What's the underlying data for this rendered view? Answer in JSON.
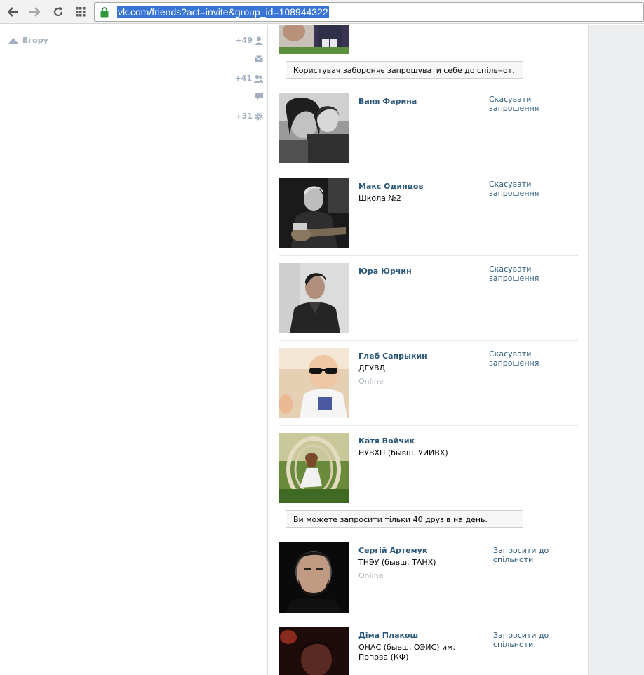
{
  "browser": {
    "url": "vk.com/friends?act=invite&group_id=108944322"
  },
  "sidebar": {
    "up_label": "Вгору",
    "counters": [
      {
        "count": "+49",
        "icon": "user-icon"
      },
      {
        "count": "",
        "icon": "mail-icon"
      },
      {
        "count": "+41",
        "icon": "users-icon"
      },
      {
        "count": "",
        "icon": "comment-icon"
      },
      {
        "count": "+31",
        "icon": "gear-icon"
      }
    ]
  },
  "notices": [
    "Користувач забороняє запрошувати себе до спільнот.",
    "Ви можете запросити тільки 40 друзів на день."
  ],
  "friends": [
    {
      "name": "Ваня Фарина",
      "sub": "",
      "online": "",
      "action": "Скасувати запрошення"
    },
    {
      "name": "Макс Одинцов",
      "sub": "Школа №2",
      "online": "",
      "action": "Скасувати запрошення"
    },
    {
      "name": "Юра Юрчин",
      "sub": "",
      "online": "",
      "action": "Скасувати запрошення"
    },
    {
      "name": "Глеб Сапрыкин",
      "sub": "ДГУВД",
      "online": "Online",
      "action": "Скасувати запрошення"
    },
    {
      "name": "Катя Войчик",
      "sub": "НУВХП (бывш. УИИВХ)",
      "online": "",
      "action": ""
    },
    {
      "name": "Сергій Артемук",
      "sub": "ТНЭУ (бывш. ТАНХ)",
      "online": "Online",
      "action": "Запросити до спільноти"
    },
    {
      "name": "Діма Плакош",
      "sub": "ОНАС (бывш. ОЭИС) им. Попова (КФ)",
      "online": "",
      "action": "Запросити до спільноти"
    }
  ]
}
